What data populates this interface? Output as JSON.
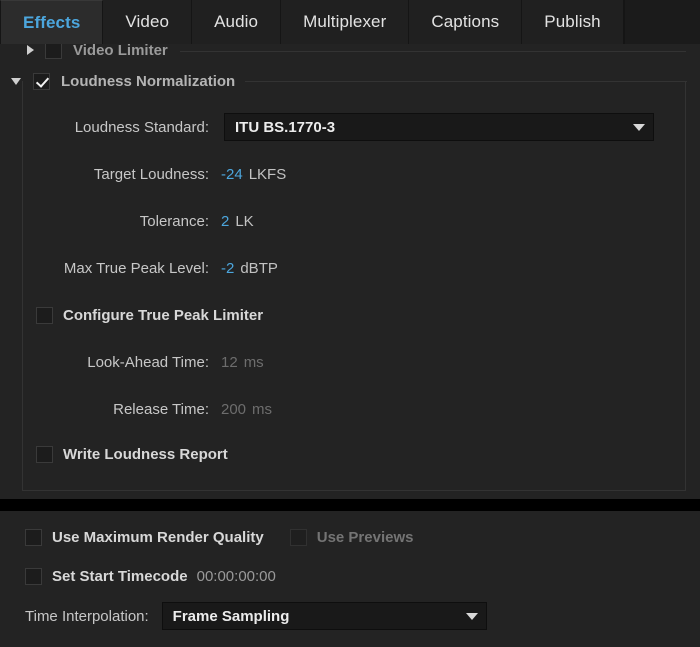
{
  "tabs": [
    {
      "label": "Effects",
      "active": true
    },
    {
      "label": "Video",
      "active": false
    },
    {
      "label": "Audio",
      "active": false
    },
    {
      "label": "Multiplexer",
      "active": false
    },
    {
      "label": "Captions",
      "active": false
    },
    {
      "label": "Publish",
      "active": false
    }
  ],
  "effects": {
    "video_limiter": {
      "title": "Video Limiter",
      "expanded": false,
      "checked": false
    },
    "loudness_normalization": {
      "title": "Loudness Normalization",
      "expanded": true,
      "checked": true,
      "loudness_standard": {
        "label": "Loudness Standard:",
        "value": "ITU BS.1770-3"
      },
      "target_loudness": {
        "label": "Target Loudness:",
        "value": "-24",
        "unit": "LKFS"
      },
      "tolerance": {
        "label": "Tolerance:",
        "value": "2",
        "unit": "LK"
      },
      "max_true_peak_level": {
        "label": "Max True Peak Level:",
        "value": "-2",
        "unit": "dBTP"
      },
      "configure_true_peak_limiter": {
        "label": "Configure True Peak Limiter",
        "checked": false
      },
      "look_ahead_time": {
        "label": "Look-Ahead Time:",
        "value": "12",
        "unit": "ms",
        "disabled": true
      },
      "release_time": {
        "label": "Release Time:",
        "value": "200",
        "unit": "ms",
        "disabled": true
      },
      "write_loudness_report": {
        "label": "Write Loudness Report",
        "checked": false
      }
    }
  },
  "bottom": {
    "use_maximum_render_quality": {
      "label": "Use Maximum Render Quality",
      "checked": false
    },
    "use_previews": {
      "label": "Use Previews",
      "checked": false,
      "disabled": true
    },
    "set_start_timecode": {
      "label": "Set Start Timecode",
      "checked": false,
      "timecode": "00:00:00:00"
    },
    "time_interpolation": {
      "label": "Time Interpolation:",
      "value": "Frame Sampling"
    }
  },
  "colors": {
    "accent_blue": "#4ca6dd",
    "panel_bg": "#232323",
    "tabbar_bg": "#1b1b1b",
    "tab_active_bg": "#2c2c2c",
    "field_bg": "#191919",
    "label_gray": "#c7c7c7",
    "disabled_gray": "#6d6d6d",
    "separator_black": "#000000"
  }
}
